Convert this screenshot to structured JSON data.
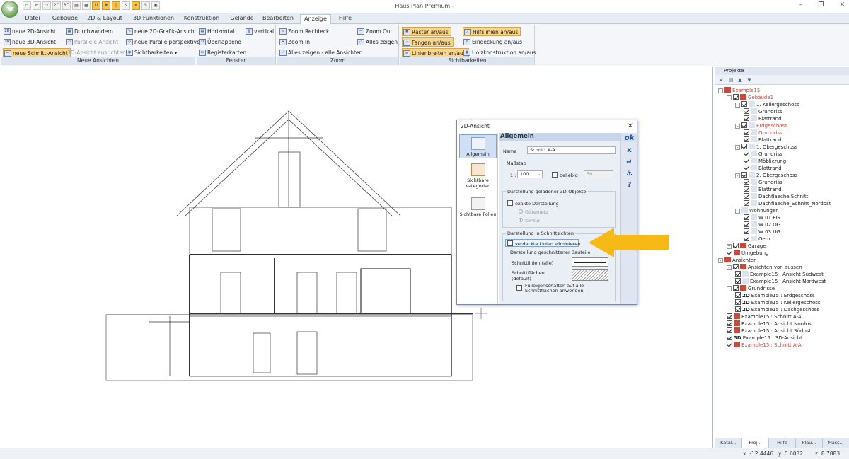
{
  "app": {
    "title": "Haus Plan Premium -"
  },
  "menu_tabs": [
    "Datei",
    "Gebäude",
    "2D & Layout",
    "3D Funktionen",
    "Konstruktion",
    "Gelände",
    "Bearbeiten",
    "Anzeige",
    "Hilfe"
  ],
  "ribbon": {
    "neue_ansichten": {
      "title": "Neue Ansichten",
      "items": [
        "neue 2D-Ansicht",
        "neue 3D-Ansicht",
        "neue Schnitt-Ansicht",
        "Durchwandern",
        "Parallele Ansicht",
        "3D-Ansicht ausrichten",
        "neue 2D-Grafik-Ansicht",
        "neue Parallelperspektive",
        "Sichtbarkeiten"
      ]
    },
    "fenster": {
      "title": "Fenster",
      "items": [
        "Horizontal",
        "vertikal",
        "Überlappend",
        "Registerkarten"
      ]
    },
    "zoom": {
      "title": "Zoom",
      "items": [
        "Zoom Rechteck",
        "Zoom Out",
        "Zoom In",
        "Alles zeigen",
        "Alles zeigen - alle Ansichten"
      ]
    },
    "sichtbarkeiten": {
      "title": "Sichtbarkeiten",
      "items": [
        "Raster an/aus",
        "Fangen an/aus",
        "Linienbreiten an/aus",
        "Hilfslinien an/aus",
        "Eindeckung an/aus",
        "Holzkonstruktion an/aus"
      ]
    }
  },
  "panel": {
    "title": "Projekte",
    "tree": [
      {
        "label": "Example15",
        "level": 0,
        "red": true,
        "exp": "-"
      },
      {
        "label": "Gebäude1",
        "level": 1,
        "red": true,
        "exp": "-",
        "cb": true
      },
      {
        "label": "1. Kellergeschoss",
        "level": 2,
        "exp": "-",
        "cb": true
      },
      {
        "label": "Grundriss",
        "level": 3,
        "cb": true
      },
      {
        "label": "Blattrand",
        "level": 3,
        "cb": true
      },
      {
        "label": "Erdgeschoss",
        "level": 2,
        "red": true,
        "exp": "-",
        "cb": true
      },
      {
        "label": "Grundriss",
        "level": 3,
        "red": true,
        "cb": true
      },
      {
        "label": "Blattrand",
        "level": 3,
        "cb": true
      },
      {
        "label": "1. Obergeschoss",
        "level": 2,
        "exp": "-",
        "cb": true
      },
      {
        "label": "Grundriss",
        "level": 3,
        "cb": true
      },
      {
        "label": "Möblierung",
        "level": 3,
        "cb": true
      },
      {
        "label": "Blattrand",
        "level": 3,
        "cb": true
      },
      {
        "label": "2. Obergeschoss",
        "level": 2,
        "exp": "-",
        "cb": true
      },
      {
        "label": "Grundriss",
        "level": 3,
        "cb": true
      },
      {
        "label": "Blattrand",
        "level": 3,
        "cb": true
      },
      {
        "label": "Dachflaeche Schnitt",
        "level": 3,
        "cb": true
      },
      {
        "label": "Dachflaeche_Schnitt_Nordost",
        "level": 3,
        "cb": true
      },
      {
        "label": "Wohnungen",
        "level": 2,
        "exp": "-"
      },
      {
        "label": "W 01 EG",
        "level": 3,
        "cb": true
      },
      {
        "label": "W 02 OG",
        "level": 3,
        "cb": true
      },
      {
        "label": "W 03 UG",
        "level": 3,
        "cb": true
      },
      {
        "label": "Gem",
        "level": 3,
        "cb": true
      },
      {
        "label": "Garage",
        "level": 1,
        "exp": "+",
        "cb": true
      },
      {
        "label": "Umgebung",
        "level": 1,
        "cb": true
      },
      {
        "label": "Ansichten",
        "level": 0,
        "exp": "-"
      },
      {
        "label": "Ansichten von aussen",
        "level": 1,
        "exp": "-",
        "cb": true
      },
      {
        "label": "Example15 : Ansicht Südwest",
        "level": 2,
        "cb": true
      },
      {
        "label": "Example15 : Ansicht Nordwest",
        "level": 2,
        "cb": true
      },
      {
        "label": "Grundrisse",
        "level": 1,
        "exp": "-",
        "cb": true
      },
      {
        "label": "Example15 : Erdgeschoss",
        "level": 2,
        "cb": true,
        "pre": "2D"
      },
      {
        "label": "Example15 : Kellergeschoss",
        "level": 2,
        "cb": true,
        "pre": "2D"
      },
      {
        "label": "Example15 : Dachgeschoss",
        "level": 2,
        "cb": true,
        "pre": "2D"
      },
      {
        "label": "Example15 : Schnitt A-A",
        "level": 1,
        "cb": true
      },
      {
        "label": "Example15 : Ansicht Nordost",
        "level": 1,
        "cb": true
      },
      {
        "label": "Example15 : Ansicht Südost",
        "level": 1,
        "cb": true
      },
      {
        "label": "Example15 : 3D-Ansicht",
        "level": 1,
        "cb": true,
        "pre": "3D"
      },
      {
        "label": "Example15 : Schnitt A-A",
        "level": 1,
        "red": true,
        "cb": true
      }
    ],
    "bottom_tabs": [
      "Katal...",
      "Proj...",
      "Hilfe",
      "Plau...",
      "Mass..."
    ]
  },
  "status": {
    "x": "x: -12.4446",
    "y": "y: 0.6032",
    "z": "z: 8.7883"
  },
  "dialog": {
    "title": "2D-Ansicht",
    "side": [
      "Allgemein",
      "Sichtbare Kategorien",
      "Sichtbare Folien"
    ],
    "section": "Allgemein",
    "name_label": "Name",
    "name_value": "Schnitt A-A",
    "massstab_label": "Maßstab",
    "scale_prefix": "1 :",
    "scale_value": "100",
    "beliebig_label": "beliebig",
    "beliebig_value": "50",
    "group3d_label": "Darstellung geladener 3D-Objekte",
    "exakte_label": "exakte Darstellung",
    "gitternetz_label": "Gitternetz",
    "kontur_label": "Kontur",
    "schnitt_label": "Darstellung in Schnittsichten",
    "verdeckte_label": "verdeckte Linien eliminieren",
    "geschnitten_label": "Darstellung geschnittener Bauteile",
    "schnittlinien_label": "Schnittlinien (alle)",
    "schnittflaechen_label": "Schnittflächen (default)",
    "fuell_label": "Fülleigenschaften auf alle Schnittflächen anwenden",
    "buttons": [
      "ok",
      "x",
      "↵",
      "⚓",
      "?"
    ]
  }
}
